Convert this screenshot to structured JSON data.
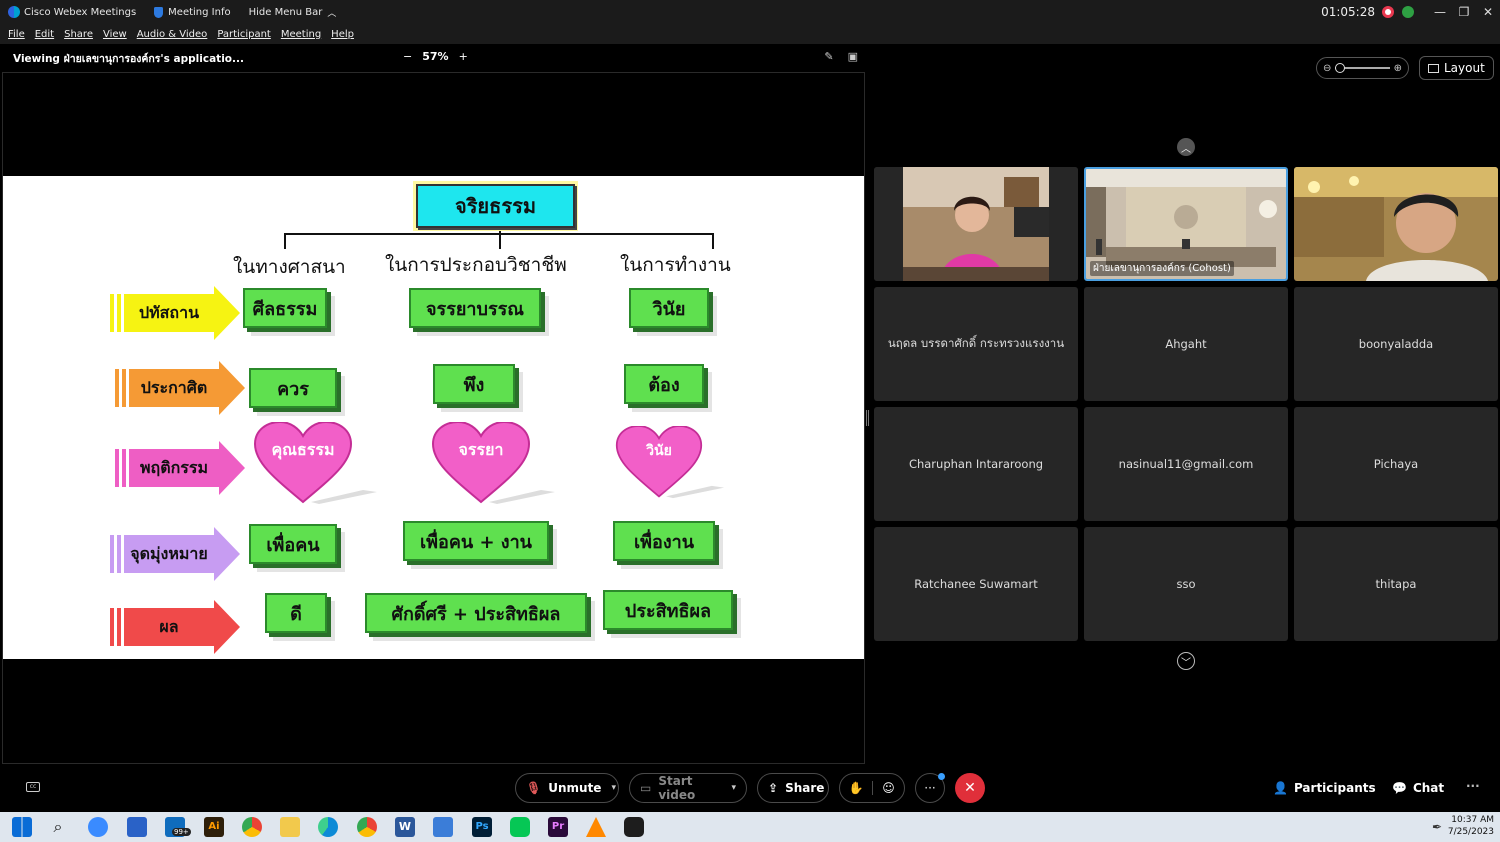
{
  "titlebar": {
    "app_name": "Cisco Webex Meetings",
    "meeting_info": "Meeting Info",
    "hide_menu": "Hide Menu Bar",
    "timer": "01:05:28"
  },
  "menu": [
    "File",
    "Edit",
    "Share",
    "View",
    "Audio & Video",
    "Participant",
    "Meeting",
    "Help"
  ],
  "viewbar": {
    "viewing": "Viewing ฝ่ายเลขานุการองค์กร's applicatio...",
    "zoom_minus": "−",
    "zoom": "57%",
    "zoom_plus": "+"
  },
  "slide": {
    "title": "จริยธรรม",
    "columns": [
      "ในทางศาสนา",
      "ในการประกอบวิชาชีพ",
      "ในการทำงาน"
    ],
    "rows": [
      {
        "label": "ปทัสถาน",
        "cells": [
          "ศีลธรรม",
          "จรรยาบรรณ",
          "วินัย"
        ]
      },
      {
        "label": "ประกาศิต",
        "cells": [
          "ควร",
          "พึง",
          "ต้อง"
        ]
      },
      {
        "label": "พฤติกรรม",
        "cells": [
          "คุณธรรม",
          "จรรยา",
          "วินัย"
        ]
      },
      {
        "label": "จุดมุ่งหมาย",
        "cells": [
          "เพื่อคน",
          "เพื่อคน + งาน",
          "เพื่องาน"
        ]
      },
      {
        "label": "ผล",
        "cells": [
          "ดี",
          "ศักดิ์ศรี + ประสิทธิผล",
          "ประสิทธิผล"
        ]
      }
    ],
    "colors": {
      "arrow_yellow": "#f6f312",
      "arrow_orange": "#f59a35",
      "arrow_pink": "#ee5ec4",
      "arrow_purple": "#c79cf2",
      "arrow_red": "#f04a4a",
      "box_green": "#5fe04f",
      "heart_pink": "#f25fc8",
      "title_cyan": "#1ee6ee"
    }
  },
  "gallery": {
    "layout_label": "Layout",
    "participants": [
      {
        "name": "",
        "video": true
      },
      {
        "name": "ฝ่ายเลขานุการองค์กร (Cohost)",
        "video": true
      },
      {
        "name": "",
        "video": true
      },
      {
        "name": "นฤดล บรรดาศักดิ์ กระทรวงแรงงาน",
        "video": false
      },
      {
        "name": "Ahgaht",
        "video": false
      },
      {
        "name": "boonyaladda",
        "video": false
      },
      {
        "name": "Charuphan Intararoong",
        "video": false
      },
      {
        "name": "nasinual11@gmail.com",
        "video": false
      },
      {
        "name": "Pichaya",
        "video": false
      },
      {
        "name": "Ratchanee Suwamart",
        "video": false
      },
      {
        "name": "sso",
        "video": false
      },
      {
        "name": "thitapa",
        "video": false
      }
    ]
  },
  "controls": {
    "unmute": "Unmute",
    "start_video": "Start video",
    "share": "Share",
    "participants": "Participants",
    "chat": "Chat",
    "more": "···"
  },
  "taskbar": {
    "time": "10:37 AM",
    "date": "7/25/2023",
    "mail_badge": "99+"
  }
}
